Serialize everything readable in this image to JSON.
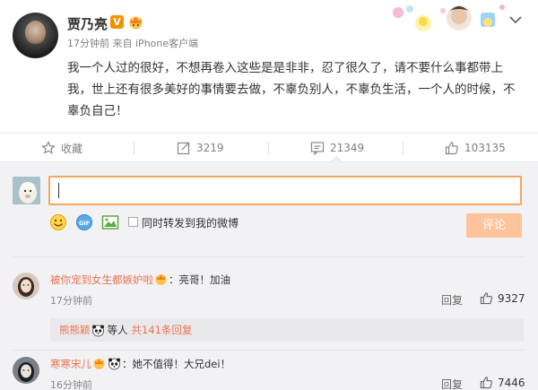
{
  "post": {
    "username": "贾乃亮",
    "verified_badge": "V",
    "time": "17分钟前",
    "source_prefix": "来自",
    "source": "iPhone客户端",
    "content": "我一个人过的很好，不想再卷入这些是是非非，忍了很久了，请不要什么事都带上我，世上还有很多美好的事情要去做，不辜负别人，不辜负生活，一个人的时候，不辜负自己！"
  },
  "actions": {
    "favorite_label": "收藏",
    "repost_count": "3219",
    "comment_count": "21349",
    "like_count": "103135"
  },
  "composer": {
    "input_value": "",
    "repost_checkbox_label": "同时转发到我的微博",
    "submit_label": "评论"
  },
  "comments": [
    {
      "user": "被你宠到女生都嫉妒啦",
      "text": "：亮哥！加油",
      "time": "17分钟前",
      "reply_label": "回复",
      "likes": "9327",
      "sub_reply": {
        "user": "熊熊颖",
        "mid": "等人",
        "link": "共141条回复"
      }
    },
    {
      "user": "寒寒宋儿",
      "text": "：她不值得！大兄dei！",
      "time": "16分钟前",
      "reply_label": "回复",
      "likes": "7446"
    }
  ],
  "colors": {
    "accent_orange": "#eb7350",
    "input_border": "#f5a660",
    "submit_disabled": "#fdc39b",
    "verified": "#f29100",
    "comment_bg": "#f2f2f5"
  },
  "icons": [
    "star-icon",
    "repost-icon",
    "comment-icon",
    "thumb-up-icon",
    "chevron-down-icon",
    "smiley-icon",
    "gif-icon",
    "image-icon",
    "panda-emoji-icon",
    "crown-icon"
  ]
}
